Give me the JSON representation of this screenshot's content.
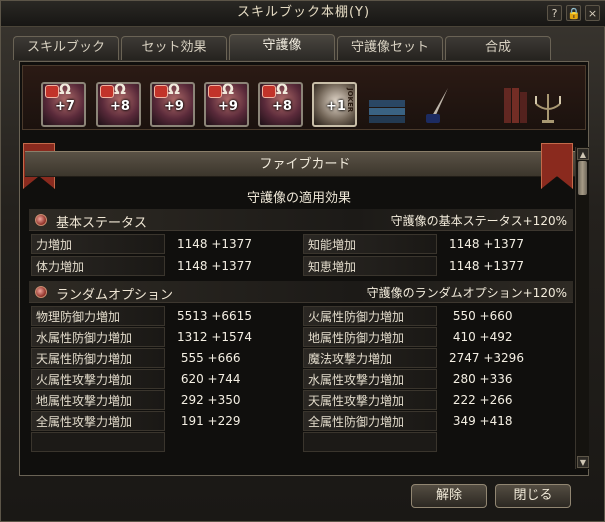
{
  "window": {
    "title": "スキルブック本棚(Y)"
  },
  "titlebar_icons": [
    "help-icon",
    "lock-icon",
    "close-icon"
  ],
  "titlebar_glyphs": {
    "help": "?",
    "lock": "🔒",
    "close": "×"
  },
  "tabs": [
    {
      "label": "スキルブック",
      "active": false
    },
    {
      "label": "セット効果",
      "active": false
    },
    {
      "label": "守護像",
      "active": true
    },
    {
      "label": "守護像セット",
      "active": false
    },
    {
      "label": "合成",
      "active": false
    }
  ],
  "slots": [
    {
      "plus": "+7",
      "locked": true
    },
    {
      "plus": "+8",
      "locked": true
    },
    {
      "plus": "+9",
      "locked": true
    },
    {
      "plus": "+9",
      "locked": true
    },
    {
      "plus": "+8",
      "locked": true
    },
    {
      "plus": "+1",
      "locked": false,
      "card_text": "JOKER"
    }
  ],
  "slot_omega": "Ω",
  "shelf_decor": [
    "books-icon",
    "quill-ink-icon",
    "book-stack-icon",
    "candelabra-icon"
  ],
  "banner": {
    "title": "ファイブカード"
  },
  "effects_heading": "守護像の適用効果",
  "basic_status": {
    "label": "基本ステータス",
    "bonus": "守護像の基本ステータス+120%",
    "rows": [
      {
        "left_name": "力増加",
        "left_value": "1148 +1377",
        "right_name": "知能増加",
        "right_value": "1148 +1377"
      },
      {
        "left_name": "体力増加",
        "left_value": "1148 +1377",
        "right_name": "知恵増加",
        "right_value": "1148 +1377"
      }
    ]
  },
  "random_options": {
    "label": "ランダムオプション",
    "bonus": "守護像のランダムオプション+120%",
    "rows": [
      {
        "left_name": "物理防御力増加",
        "left_value": "5513 +6615",
        "right_name": "火属性防御力増加",
        "right_value": " 550 +660"
      },
      {
        "left_name": "水属性防御力増加",
        "left_value": "1312 +1574",
        "right_name": "地属性防御力増加",
        "right_value": " 410 +492"
      },
      {
        "left_name": "天属性防御力増加",
        "left_value": " 555 +666",
        "right_name": "魔法攻撃力増加",
        "right_value": "2747 +3296"
      },
      {
        "left_name": "火属性攻撃力増加",
        "left_value": " 620 +744",
        "right_name": "水属性攻撃力増加",
        "right_value": " 280 +336"
      },
      {
        "left_name": "地属性攻撃力増加",
        "left_value": " 292 +350",
        "right_name": "天属性攻撃力増加",
        "right_value": " 222 +266"
      },
      {
        "left_name": "全属性攻撃力増加",
        "left_value": " 191 +229",
        "right_name": "全属性防御力増加",
        "right_value": " 349 +418"
      },
      {
        "left_name": "",
        "left_value": "",
        "right_name": "",
        "right_value": ""
      }
    ]
  },
  "scroll": {
    "up": "▲",
    "down": "▼",
    "position": 0.0
  },
  "buttons": {
    "release": "解除",
    "close": "閉じる"
  }
}
